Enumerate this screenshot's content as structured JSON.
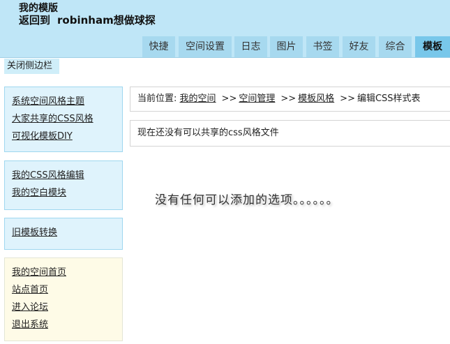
{
  "header": {
    "title": "我的模版",
    "back_prefix": "返回到",
    "back_target": "robinham想做球探"
  },
  "tabs": [
    {
      "label": "快捷"
    },
    {
      "label": "空间设置"
    },
    {
      "label": "日志"
    },
    {
      "label": "图片"
    },
    {
      "label": "书签"
    },
    {
      "label": "好友"
    },
    {
      "label": "综合"
    },
    {
      "label": "模板",
      "active": true
    }
  ],
  "sidebar": {
    "toggle_label": "关闭侧边栏",
    "group1": [
      "系统空间风格主题",
      "大家共享的CSS风格",
      "可视化模板DIY"
    ],
    "group2": [
      "我的CSS风格编辑",
      "我的空白模块"
    ],
    "group3": [
      "旧模板转换"
    ],
    "group4": [
      "我的空间首页",
      "站点首页",
      "进入论坛",
      "退出系统"
    ]
  },
  "breadcrumb": {
    "prefix": "当前位置:",
    "items": [
      "我的空间",
      "空间管理",
      "模板风格"
    ],
    "separator": ">>",
    "current": "编辑CSS样式表"
  },
  "info_text": "现在还没有可以共享的css风格文件",
  "empty_message": "没有任何可以添加的选项。。。。。。"
}
